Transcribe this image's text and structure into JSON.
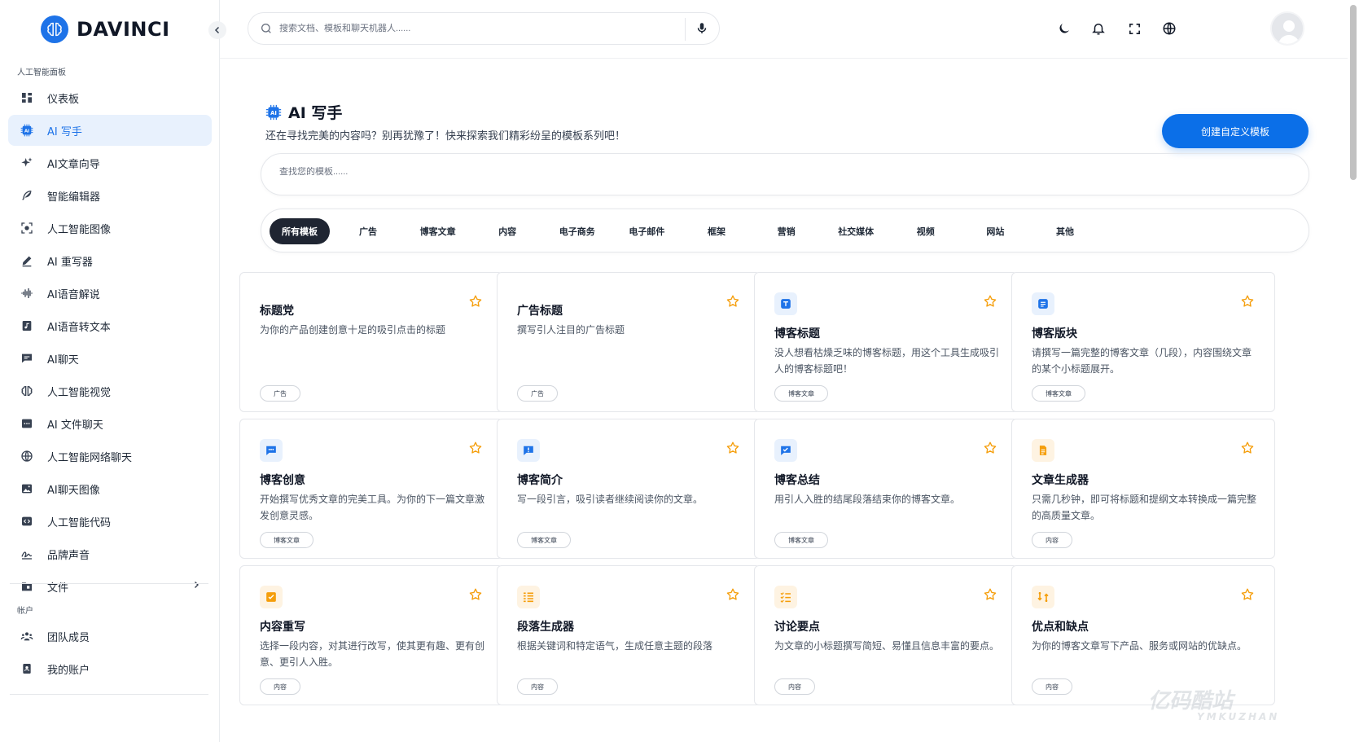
{
  "brand": {
    "name": "DAVINCI",
    "accent": "#1e73e8"
  },
  "sidebar": {
    "section_ai": "人工智能面板",
    "items": [
      {
        "label": "仪表板",
        "icon": "dashboard-icon"
      },
      {
        "label": "AI 写手",
        "icon": "ai-chip-icon",
        "active": true
      },
      {
        "label": "AI文章向导",
        "icon": "sparkles-icon"
      },
      {
        "label": "智能编辑器",
        "icon": "feather-icon"
      },
      {
        "label": "人工智能图像",
        "icon": "image-scan-icon"
      },
      {
        "label": "AI 重写器",
        "icon": "pencil-icon"
      },
      {
        "label": "AI语音解说",
        "icon": "waveform-icon"
      },
      {
        "label": "AI语音转文本",
        "icon": "music-file-icon"
      },
      {
        "label": "AI聊天",
        "icon": "chat-icon"
      },
      {
        "label": "人工智能视觉",
        "icon": "brain-icon"
      },
      {
        "label": "AI 文件聊天",
        "icon": "file-chat-icon"
      },
      {
        "label": "人工智能网络聊天",
        "icon": "globe-icon"
      },
      {
        "label": "AI聊天图像",
        "icon": "picture-icon"
      },
      {
        "label": "人工智能代码",
        "icon": "code-icon"
      },
      {
        "label": "品牌声音",
        "icon": "signature-icon"
      },
      {
        "label": "文件",
        "icon": "folder-icon"
      }
    ],
    "section_account": "帐户",
    "account_items": [
      {
        "label": "团队成员",
        "icon": "team-icon"
      },
      {
        "label": "我的账户",
        "icon": "account-icon"
      }
    ]
  },
  "header": {
    "search_placeholder": "搜索文档、模板和聊天机器人......"
  },
  "page": {
    "title": "AI 写手",
    "subtitle": "还在寻找完美的内容吗？别再犹豫了！快来探索我们精彩纷呈的模板系列吧！",
    "create_button": "创建自定义模板",
    "template_search_placeholder": "查找您的模板......"
  },
  "tabs": [
    "所有模板",
    "广告",
    "博客文章",
    "内容",
    "电子商务",
    "电子邮件",
    "框架",
    "营销",
    "社交媒体",
    "视频",
    "网站",
    "其他"
  ],
  "cards": [
    {
      "title": "标题党",
      "desc": "为你的产品创建创意十足的吸引点击的标题",
      "tag": "广告",
      "icon": "",
      "icon_color": ""
    },
    {
      "title": "广告标题",
      "desc": "撰写引人注目的广告标题",
      "tag": "广告",
      "icon": "",
      "icon_color": ""
    },
    {
      "title": "博客标题",
      "desc": "没人想看枯燥乏味的博客标题，用这个工具生成吸引人的博客标题吧！",
      "tag": "博客文章",
      "icon": "text-icon",
      "icon_color": "#1e73e8"
    },
    {
      "title": "博客版块",
      "desc": "请撰写一篇完整的博客文章（几段），内容围绕文章的某个小标题展开。",
      "tag": "博客文章",
      "icon": "doc-lines-icon",
      "icon_color": "#1e73e8"
    },
    {
      "title": "博客创意",
      "desc": "开始撰写优秀文章的完美工具。为你的下一篇文章激发创意灵感。",
      "tag": "博客文章",
      "icon": "chat-dots-icon",
      "icon_color": "#1e73e8"
    },
    {
      "title": "博客简介",
      "desc": "写一段引言，吸引读者继续阅读你的文章。",
      "tag": "博客文章",
      "icon": "alert-message-icon",
      "icon_color": "#1e73e8"
    },
    {
      "title": "博客总结",
      "desc": "用引人入胜的结尾段落结束你的博客文章。",
      "tag": "博客文章",
      "icon": "check-message-icon",
      "icon_color": "#1e73e8"
    },
    {
      "title": "文章生成器",
      "desc": "只需几秒钟，即可将标题和提纲文本转换成一篇完整的高质量文章。",
      "tag": "内容",
      "icon": "document-icon",
      "icon_color": "#f59e0b"
    },
    {
      "title": "内容重写",
      "desc": "选择一段内容，对其进行改写，使其更有趣、更有创意、更引人入胜。",
      "tag": "内容",
      "icon": "check-square-icon",
      "icon_color": "#f59e0b"
    },
    {
      "title": "段落生成器",
      "desc": "根据关键词和特定语气，生成任意主题的段落",
      "tag": "内容",
      "icon": "list-icon",
      "icon_color": "#f59e0b"
    },
    {
      "title": "讨论要点",
      "desc": "为文章的小标题撰写简短、易懂且信息丰富的要点。",
      "tag": "内容",
      "icon": "checklist-icon",
      "icon_color": "#f59e0b"
    },
    {
      "title": "优点和缺点",
      "desc": "为你的博客文章写下产品、服务或网站的优缺点。",
      "tag": "内容",
      "icon": "swap-icon",
      "icon_color": "#f59e0b"
    }
  ],
  "watermark": {
    "line1": "亿码酷站",
    "line2": "YMKUZHAN"
  }
}
